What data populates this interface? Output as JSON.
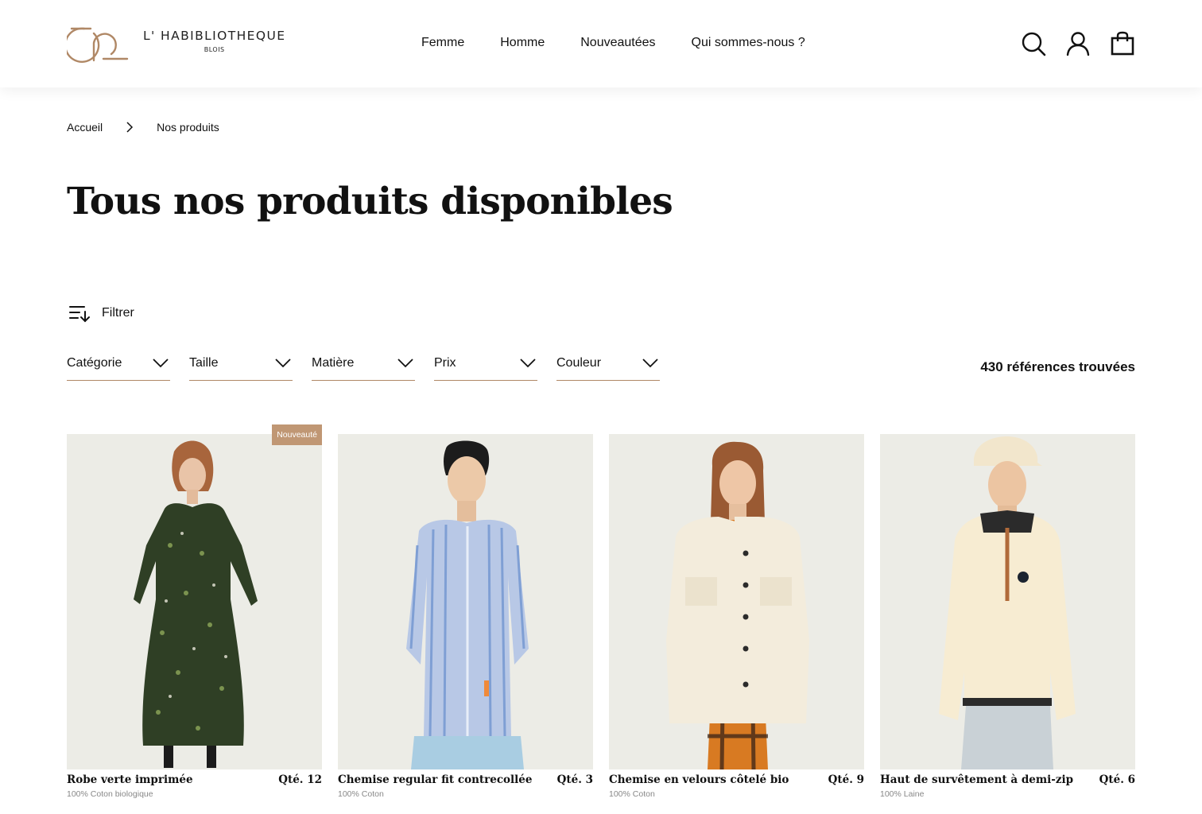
{
  "brand": {
    "name": "L' HABIBLIOTHEQUE",
    "city": "BLOIS",
    "accent": "#b08866"
  },
  "nav": [
    "Femme",
    "Homme",
    "Nouveautées",
    "Qui sommes-nous ?"
  ],
  "header_icons": [
    "search-icon",
    "user-icon",
    "shopping-bag-icon"
  ],
  "breadcrumb": {
    "home": "Accueil",
    "current": "Nos produits"
  },
  "title": "Tous nos produits disponibles",
  "filter": {
    "label": "Filtrer"
  },
  "dropdowns": [
    "Catégorie",
    "Taille",
    "Matière",
    "Prix",
    "Couleur"
  ],
  "results": "430 références trouvées",
  "products": [
    {
      "name": "Robe verte imprimée",
      "qty": "Qté. 12",
      "material": "100% Coton biologique",
      "badge": "Nouveauté"
    },
    {
      "name": "Chemise regular fit contrecollée",
      "qty": "Qté. 3",
      "material": "100% Coton",
      "badge": ""
    },
    {
      "name": "Chemise en velours côtelé bio",
      "qty": "Qté. 9",
      "material": "100% Coton",
      "badge": ""
    },
    {
      "name": "Haut de survêtement à demi-zip",
      "qty": "Qté. 6",
      "material": "100% Laine",
      "badge": ""
    }
  ]
}
